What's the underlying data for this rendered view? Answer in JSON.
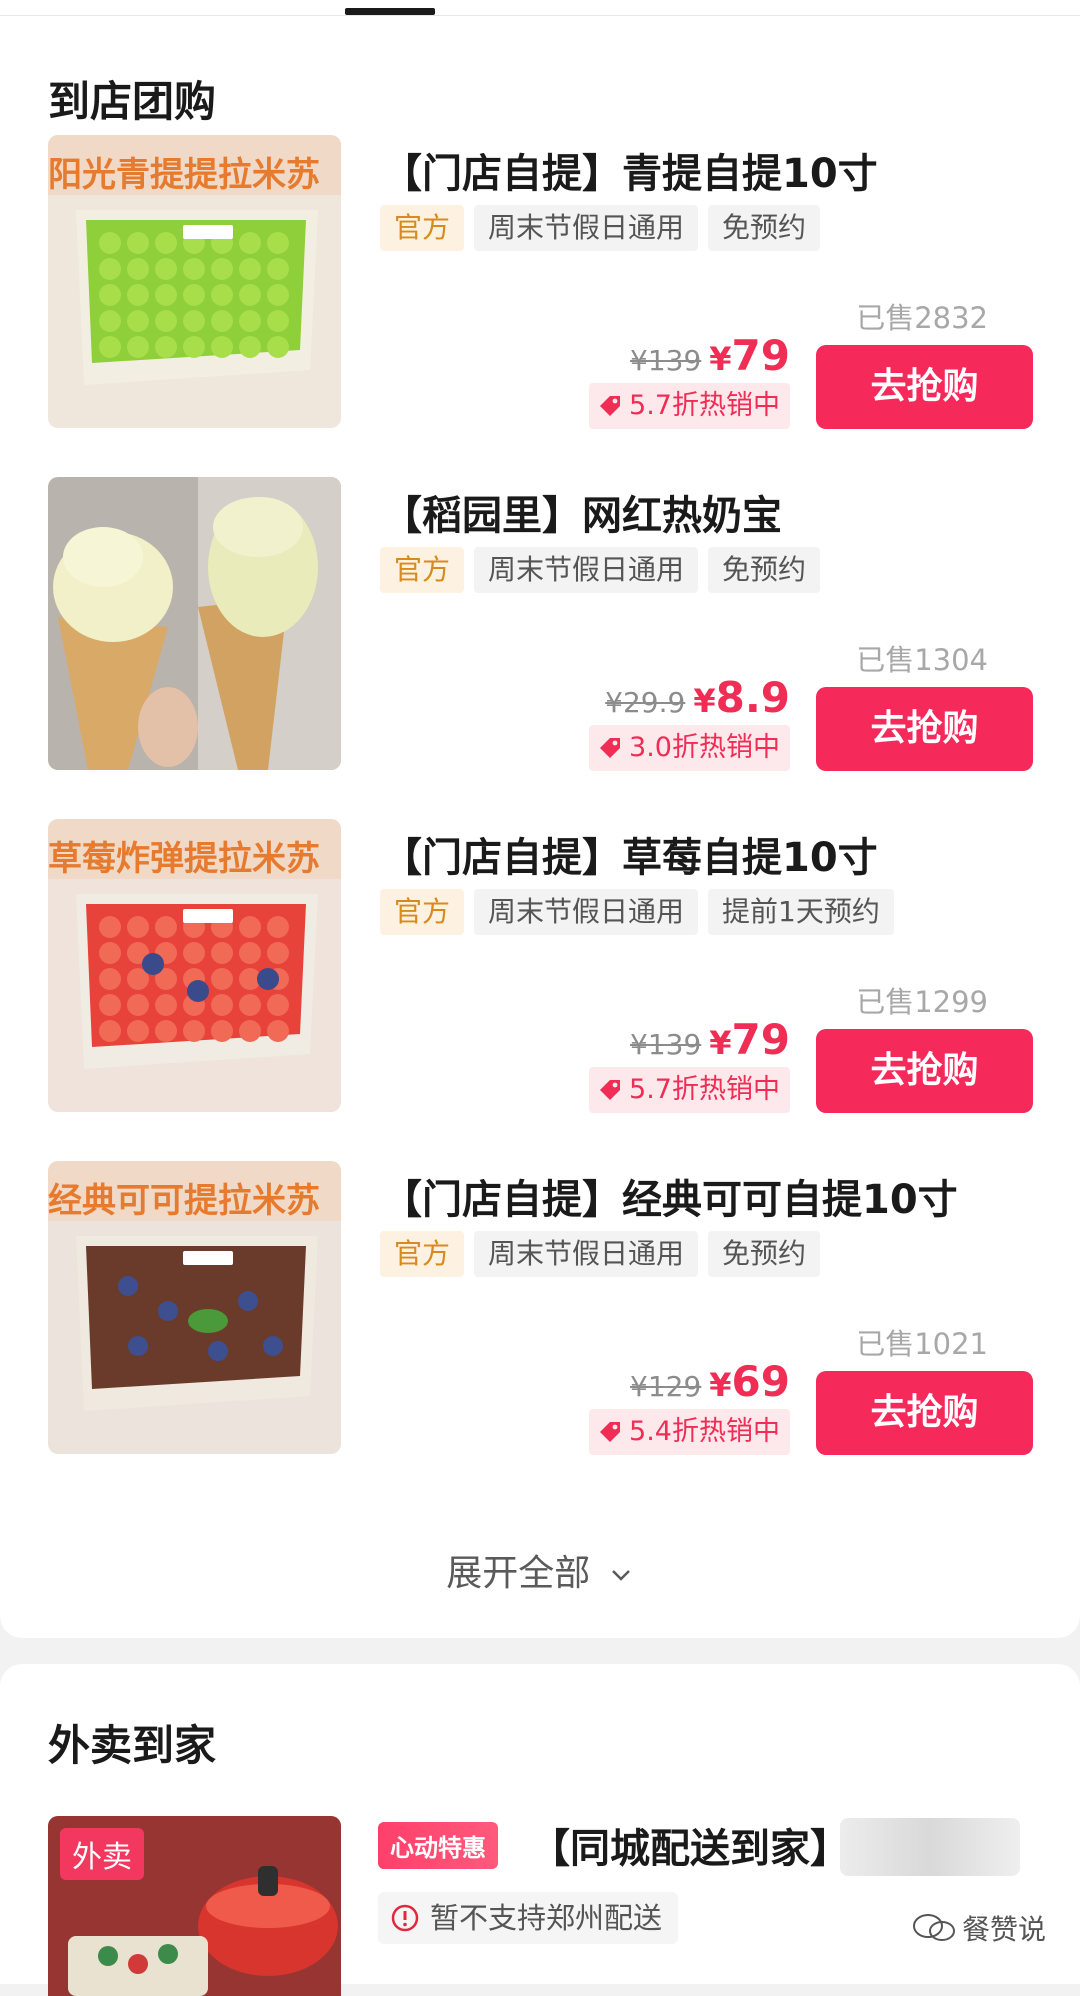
{
  "group_section": {
    "title": "到店团购",
    "expand_label": "展开全部",
    "deals": [
      {
        "title": "【门店自提】青提自提10寸",
        "tags": [
          "官方",
          "周末节假日通用",
          "免预约"
        ],
        "image_text": "阳光青提提拉米苏",
        "image_theme": "green-grape",
        "sold": "已售2832",
        "original_price": "¥139",
        "price_symbol": "¥",
        "price": "79",
        "hot_label": "5.7折热销中",
        "button_label": "去抢购"
      },
      {
        "title": "【稻园里】网红热奶宝",
        "tags": [
          "官方",
          "周末节假日通用",
          "免预约"
        ],
        "image_text": "",
        "image_theme": "ice-cream",
        "sold": "已售1304",
        "original_price": "¥29.9",
        "price_symbol": "¥",
        "price": "8.9",
        "hot_label": "3.0折热销中",
        "button_label": "去抢购"
      },
      {
        "title": "【门店自提】草莓自提10寸",
        "tags": [
          "官方",
          "周末节假日通用",
          "提前1天预约"
        ],
        "image_text": "草莓炸弹提拉米苏",
        "image_theme": "strawberry",
        "sold": "已售1299",
        "original_price": "¥139",
        "price_symbol": "¥",
        "price": "79",
        "hot_label": "5.7折热销中",
        "button_label": "去抢购"
      },
      {
        "title": "【门店自提】经典可可自提10寸",
        "tags": [
          "官方",
          "周末节假日通用",
          "免预约"
        ],
        "image_text": "经典可可提拉米苏",
        "image_theme": "cocoa",
        "sold": "已售1021",
        "original_price": "¥129",
        "price_symbol": "¥",
        "price": "69",
        "hot_label": "5.4折热销中",
        "button_label": "去抢购"
      }
    ]
  },
  "delivery_section": {
    "title": "外卖到家",
    "image_badge": "外卖",
    "promo_badge": "心动特惠",
    "item_title": "【同城配送到家】",
    "notice": "暂不支持郑州配送"
  },
  "watermark": "餐赞说",
  "colors": {
    "accent": "#f52a5b",
    "price": "#ef2d55",
    "official_tag_bg": "#fdf1e2",
    "official_tag_text": "#d98a1c"
  }
}
